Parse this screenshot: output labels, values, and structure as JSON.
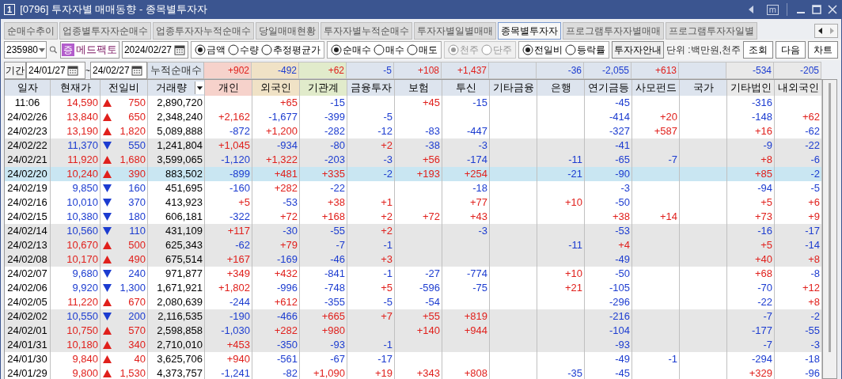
{
  "window": {
    "number": "1",
    "title": "[0796] 투자자별 매매동향 - 종목별투자자",
    "menu_key": "m"
  },
  "tabs": [
    {
      "label": "순매수추이",
      "selected": false
    },
    {
      "label": "업종별투자자순매수",
      "selected": false
    },
    {
      "label": "업종투자자누적순매수",
      "selected": false
    },
    {
      "label": "당일매매현황",
      "selected": false
    },
    {
      "label": "투자자별누적순매수",
      "selected": false
    },
    {
      "label": "투자자별일별매매",
      "selected": false
    },
    {
      "label": "종목별투자자",
      "selected": true
    },
    {
      "label": "프로그램투자자별매매",
      "selected": false
    },
    {
      "label": "프로그램투자자일별",
      "selected": false
    }
  ],
  "query": {
    "code": "235980",
    "market_badge": "증",
    "stock_name": "메드팩토",
    "date": "2024/02/27",
    "radio_groups": [
      {
        "disabled": false,
        "options": [
          {
            "label": "금액",
            "selected": true
          },
          {
            "label": "수량",
            "selected": false
          },
          {
            "label": "추정평균가",
            "selected": false
          }
        ]
      },
      {
        "disabled": false,
        "options": [
          {
            "label": "순매수",
            "selected": true
          },
          {
            "label": "매수",
            "selected": false
          },
          {
            "label": "매도",
            "selected": false
          }
        ]
      },
      {
        "disabled": true,
        "options": [
          {
            "label": "천주",
            "selected": true
          },
          {
            "label": "단주",
            "selected": false
          }
        ]
      },
      {
        "disabled": false,
        "options": [
          {
            "label": "전일비",
            "selected": true
          },
          {
            "label": "등락률",
            "selected": false
          }
        ]
      }
    ],
    "guide_button": "투자자안내",
    "unit": "단위 :백만원,천주",
    "buttons": [
      "조회",
      "다음",
      "차트"
    ]
  },
  "period": {
    "label": "기간",
    "from": "24/01/27",
    "separator": "~",
    "to": "24/02/27",
    "totals_label": "누적순매수",
    "totals": {
      "individual": "+902",
      "foreign": "-492",
      "institution": "+62",
      "financial_investment": "-5",
      "insurance": "+108",
      "investment_trust": "+1,437",
      "bank": "-36",
      "pension": "-2,055",
      "private_fund": "+613",
      "other_corp": "-534",
      "domestic_foreign": "-205"
    }
  },
  "table": {
    "columns": [
      "일자",
      "현재가",
      "전일비",
      "거래량",
      "개인",
      "외국인",
      "기관계",
      "금융투자",
      "보험",
      "투신",
      "기타금융",
      "은행",
      "연기금등",
      "사모펀드",
      "국가",
      "기타법인",
      "내외국인"
    ],
    "rows": [
      {
        "date": "11:06",
        "price": "14,590",
        "rising": true,
        "change": "750",
        "volume": "2,890,720",
        "selected": false,
        "investors": {
          "foreign": "+65",
          "institution": "-15",
          "insurance": "+45",
          "investment_trust": "-15",
          "pension": "-45",
          "other_corp": "-316"
        }
      },
      {
        "date": "24/02/26",
        "price": "13,840",
        "rising": true,
        "change": "650",
        "volume": "2,348,240",
        "selected": false,
        "investors": {
          "individual": "+2,162",
          "foreign": "-1,677",
          "institution": "-399",
          "financial_investment": "-5",
          "pension": "-414",
          "private_fund": "+20",
          "other_corp": "-148",
          "domestic_foreign": "+62"
        }
      },
      {
        "date": "24/02/23",
        "price": "13,190",
        "rising": true,
        "change": "1,820",
        "volume": "5,089,888",
        "selected": false,
        "investors": {
          "individual": "-872",
          "foreign": "+1,200",
          "institution": "-282",
          "financial_investment": "-12",
          "insurance": "-83",
          "investment_trust": "-447",
          "pension": "-327",
          "private_fund": "+587",
          "other_corp": "+16",
          "domestic_foreign": "-62"
        }
      },
      {
        "date": "24/02/22",
        "price": "11,370",
        "rising": false,
        "change": "550",
        "volume": "1,241,804",
        "selected": false,
        "investors": {
          "individual": "+1,045",
          "foreign": "-934",
          "institution": "-80",
          "financial_investment": "+2",
          "insurance": "-38",
          "investment_trust": "-3",
          "pension": "-41",
          "other_corp": "-9",
          "domestic_foreign": "-22"
        }
      },
      {
        "date": "24/02/21",
        "price": "11,920",
        "rising": true,
        "change": "1,680",
        "volume": "3,599,065",
        "selected": false,
        "investors": {
          "individual": "-1,120",
          "foreign": "+1,322",
          "institution": "-203",
          "financial_investment": "-3",
          "insurance": "+56",
          "investment_trust": "-174",
          "bank": "-11",
          "pension": "-65",
          "private_fund": "-7",
          "other_corp": "+8",
          "domestic_foreign": "-6"
        }
      },
      {
        "date": "24/02/20",
        "price": "10,240",
        "rising": true,
        "change": "390",
        "volume": "883,502",
        "selected": true,
        "investors": {
          "individual": "-899",
          "foreign": "+481",
          "institution": "+335",
          "financial_investment": "-2",
          "insurance": "+193",
          "investment_trust": "+254",
          "bank": "-21",
          "pension": "-90",
          "other_corp": "+85",
          "domestic_foreign": "-2"
        }
      },
      {
        "date": "24/02/19",
        "price": "9,850",
        "rising": false,
        "change": "160",
        "volume": "451,695",
        "selected": false,
        "investors": {
          "individual": "-160",
          "foreign": "+282",
          "institution": "-22",
          "investment_trust": "-18",
          "pension": "-3",
          "other_corp": "-94",
          "domestic_foreign": "-5"
        }
      },
      {
        "date": "24/02/16",
        "price": "10,010",
        "rising": false,
        "change": "370",
        "volume": "413,923",
        "selected": false,
        "investors": {
          "individual": "+5",
          "foreign": "-53",
          "institution": "+38",
          "financial_investment": "+1",
          "investment_trust": "+77",
          "bank": "+10",
          "pension": "-50",
          "other_corp": "+5",
          "domestic_foreign": "+6"
        }
      },
      {
        "date": "24/02/15",
        "price": "10,380",
        "rising": false,
        "change": "180",
        "volume": "606,181",
        "selected": false,
        "investors": {
          "individual": "-322",
          "foreign": "+72",
          "institution": "+168",
          "financial_investment": "+2",
          "insurance": "+72",
          "investment_trust": "+43",
          "pension": "+38",
          "private_fund": "+14",
          "other_corp": "+73",
          "domestic_foreign": "+9"
        }
      },
      {
        "date": "24/02/14",
        "price": "10,560",
        "rising": false,
        "change": "110",
        "volume": "431,109",
        "selected": false,
        "investors": {
          "individual": "+117",
          "foreign": "-30",
          "institution": "-55",
          "financial_investment": "+2",
          "investment_trust": "-3",
          "pension": "-53",
          "other_corp": "-16",
          "domestic_foreign": "-17"
        }
      },
      {
        "date": "24/02/13",
        "price": "10,670",
        "rising": true,
        "change": "500",
        "volume": "625,343",
        "selected": false,
        "investors": {
          "individual": "-62",
          "foreign": "+79",
          "institution": "-7",
          "financial_investment": "-1",
          "bank": "-11",
          "pension": "+4",
          "other_corp": "+5",
          "domestic_foreign": "-14"
        }
      },
      {
        "date": "24/02/08",
        "price": "10,170",
        "rising": true,
        "change": "490",
        "volume": "675,514",
        "selected": false,
        "investors": {
          "individual": "+167",
          "foreign": "-169",
          "institution": "-46",
          "financial_investment": "+3",
          "pension": "-49",
          "other_corp": "+40",
          "domestic_foreign": "+8"
        }
      },
      {
        "date": "24/02/07",
        "price": "9,680",
        "rising": false,
        "change": "240",
        "volume": "971,877",
        "selected": false,
        "investors": {
          "individual": "+349",
          "foreign": "+432",
          "institution": "-841",
          "financial_investment": "-1",
          "insurance": "-27",
          "investment_trust": "-774",
          "bank": "+10",
          "pension": "-50",
          "other_corp": "+68",
          "domestic_foreign": "-8"
        }
      },
      {
        "date": "24/02/06",
        "price": "9,920",
        "rising": false,
        "change": "1,300",
        "volume": "1,671,921",
        "selected": false,
        "investors": {
          "individual": "+1,802",
          "foreign": "-996",
          "institution": "-748",
          "financial_investment": "+5",
          "insurance": "-596",
          "investment_trust": "-75",
          "bank": "+21",
          "pension": "-105",
          "other_corp": "-70",
          "domestic_foreign": "+12"
        }
      },
      {
        "date": "24/02/05",
        "price": "11,220",
        "rising": true,
        "change": "670",
        "volume": "2,080,639",
        "selected": false,
        "investors": {
          "individual": "-244",
          "foreign": "+612",
          "institution": "-355",
          "financial_investment": "-5",
          "insurance": "-54",
          "pension": "-296",
          "other_corp": "-22",
          "domestic_foreign": "+8"
        }
      },
      {
        "date": "24/02/02",
        "price": "10,550",
        "rising": false,
        "change": "200",
        "volume": "2,116,535",
        "selected": false,
        "investors": {
          "individual": "-190",
          "foreign": "-466",
          "institution": "+665",
          "financial_investment": "+7",
          "insurance": "+55",
          "investment_trust": "+819",
          "pension": "-216",
          "other_corp": "-7",
          "domestic_foreign": "-2"
        }
      },
      {
        "date": "24/02/01",
        "price": "10,750",
        "rising": true,
        "change": "570",
        "volume": "2,598,858",
        "selected": false,
        "investors": {
          "individual": "-1,030",
          "foreign": "+282",
          "institution": "+980",
          "insurance": "+140",
          "investment_trust": "+944",
          "pension": "-104",
          "other_corp": "-177",
          "domestic_foreign": "-55"
        }
      },
      {
        "date": "24/01/31",
        "price": "10,180",
        "rising": true,
        "change": "340",
        "volume": "2,710,010",
        "selected": false,
        "investors": {
          "individual": "+453",
          "foreign": "-350",
          "institution": "-93",
          "financial_investment": "-1",
          "pension": "-93",
          "other_corp": "-7",
          "domestic_foreign": "-3"
        }
      },
      {
        "date": "24/01/30",
        "price": "9,840",
        "rising": true,
        "change": "40",
        "volume": "3,625,706",
        "selected": false,
        "investors": {
          "individual": "+940",
          "foreign": "-561",
          "institution": "-67",
          "financial_investment": "-17",
          "pension": "-49",
          "private_fund": "-1",
          "other_corp": "-294",
          "domestic_foreign": "-18"
        }
      },
      {
        "date": "24/01/29",
        "price": "9,800",
        "rising": true,
        "change": "1,530",
        "volume": "4,373,757",
        "selected": false,
        "investors": {
          "individual": "-1,241",
          "foreign": "-82",
          "institution": "+1,090",
          "financial_investment": "+19",
          "insurance": "+343",
          "investment_trust": "+808",
          "bank": "-35",
          "pension": "-45",
          "other_corp": "+329",
          "domestic_foreign": "-96"
        }
      }
    ]
  }
}
